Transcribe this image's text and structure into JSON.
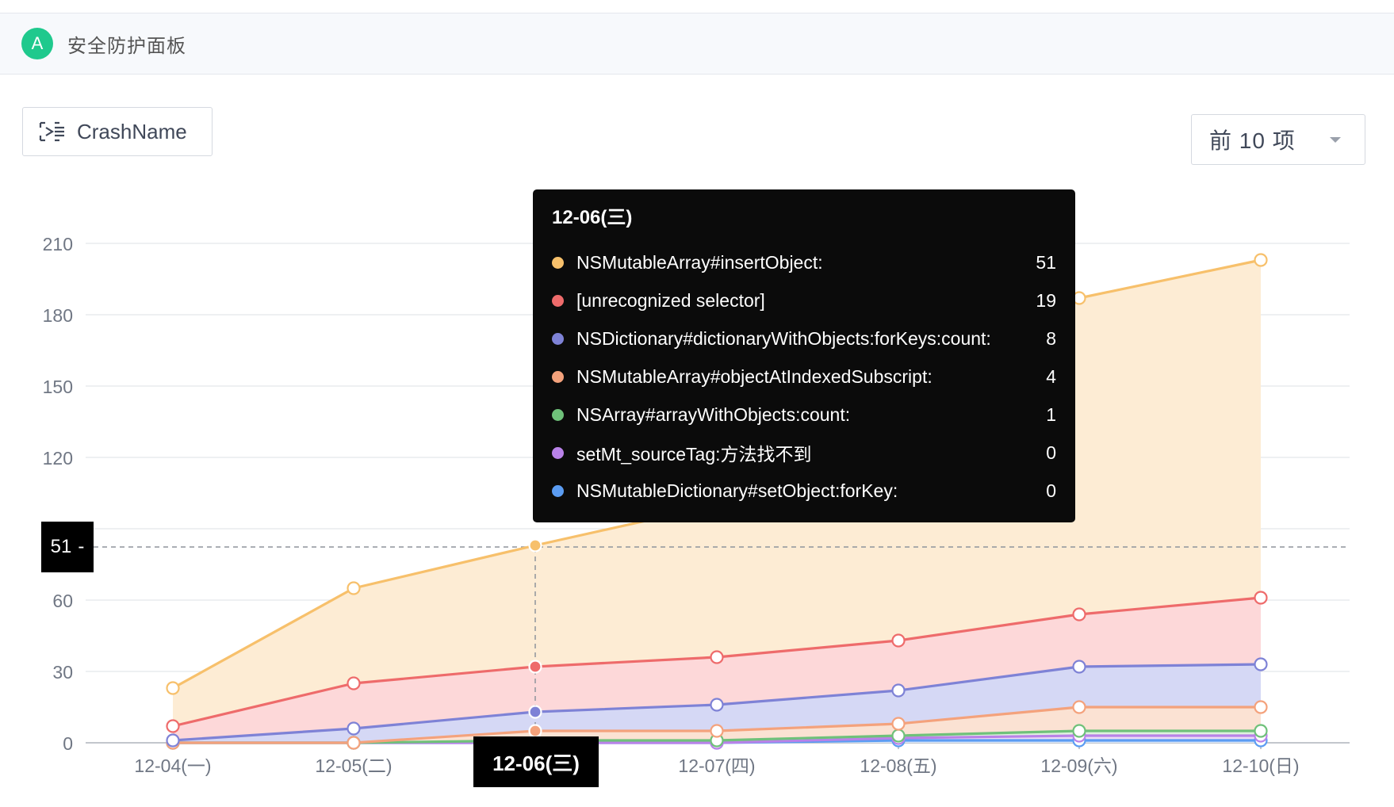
{
  "header": {
    "avatar_letter": "A",
    "title": "安全防护面板"
  },
  "toolbar": {
    "dimension_label": "CrashName",
    "select_value": "前 10 项"
  },
  "colors": {
    "NSMutableArray#insertObject:": "#f7c06b",
    "[unrecognized selector]": "#ee6b6b",
    "NSDictionary#dictionaryWithObjects:forKeys:count:": "#7e82d6",
    "NSMutableArray#objectAtIndexedSubscript:": "#f4a27c",
    "NSArray#arrayWithObjects:count:": "#6fc17a",
    "setMt_sourceTag:方法找不到": "#b982e8",
    "NSMutableDictionary#setObject:forKey:": "#5b9cf2"
  },
  "tooltip": {
    "title": "12-06(三)",
    "rows": [
      {
        "name": "NSMutableArray#insertObject:",
        "value": "51",
        "color": "#f7c06b"
      },
      {
        "name": "[unrecognized selector]",
        "value": "19",
        "color": "#ee6b6b"
      },
      {
        "name": "NSDictionary#dictionaryWithObjects:forKeys:count:",
        "value": "8",
        "color": "#7e82d6"
      },
      {
        "name": "NSMutableArray#objectAtIndexedSubscript:",
        "value": "4",
        "color": "#f4a27c"
      },
      {
        "name": "NSArray#arrayWithObjects:count:",
        "value": "1",
        "color": "#6fc17a"
      },
      {
        "name": "setMt_sourceTag:方法找不到",
        "value": "0",
        "color": "#b982e8"
      },
      {
        "name": "NSMutableDictionary#setObject:forKey:",
        "value": "0",
        "color": "#5b9cf2"
      }
    ]
  },
  "crosshair": {
    "y_label": "51",
    "x_label": "12-06(三)"
  },
  "chart_data": {
    "type": "area",
    "stacked": true,
    "categories": [
      "12-04(一)",
      "12-05(二)",
      "12-06(三)",
      "12-07(四)",
      "12-08(五)",
      "12-09(六)",
      "12-10(日)"
    ],
    "y_ticks": [
      "0",
      "30",
      "60",
      "51",
      "120",
      "150",
      "180",
      "210"
    ],
    "note_y_axis": "broken scale: visual bands read 0,30,60,(51 crosshair),120,150,180,210",
    "hover_index": 2,
    "series": [
      {
        "name": "NSMutableArray#insertObject:",
        "color": "#f7c06b",
        "stack_tops": [
          23,
          65,
          83,
          100,
          140,
          187,
          203
        ]
      },
      {
        "name": "[unrecognized selector]",
        "color": "#ee6b6b",
        "stack_tops": [
          7,
          25,
          32,
          36,
          43,
          54,
          61
        ]
      },
      {
        "name": "NSDictionary#dictionaryWithObjects:forKeys:count:",
        "color": "#7e82d6",
        "stack_tops": [
          1,
          6,
          13,
          16,
          22,
          32,
          33
        ]
      },
      {
        "name": "NSMutableArray#objectAtIndexedSubscript:",
        "color": "#f4a27c",
        "stack_tops": [
          0,
          0,
          5,
          5,
          8,
          15,
          15
        ]
      },
      {
        "name": "NSArray#arrayWithObjects:count:",
        "color": "#6fc17a",
        "stack_tops": [
          0,
          0,
          1,
          1,
          3,
          5,
          5
        ]
      },
      {
        "name": "setMt_sourceTag:方法找不到",
        "color": "#b982e8",
        "stack_tops": [
          0,
          0,
          0,
          0,
          2,
          3,
          3
        ]
      },
      {
        "name": "NSMutableDictionary#setObject:forKey:",
        "color": "#5b9cf2",
        "stack_tops": [
          0,
          0,
          0,
          0,
          1,
          1,
          1
        ]
      }
    ]
  }
}
